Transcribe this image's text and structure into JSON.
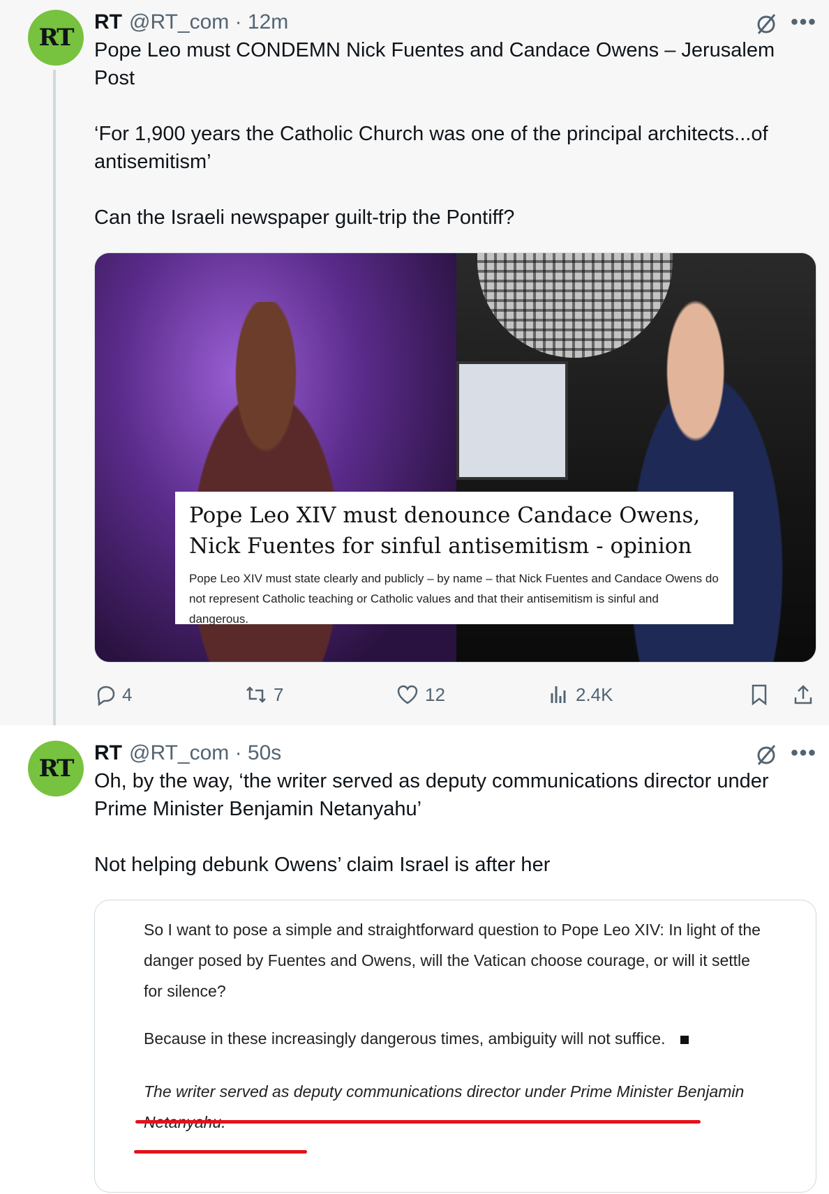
{
  "tweet1": {
    "avatar_text": "RT",
    "name": "RT",
    "handle_time": "@RT_com · 12m",
    "body": "Pope Leo must CONDEMN Nick Fuentes and Candace Owens – Jerusalem Post\n\n‘For 1,900 years the Catholic Church was one of the principal architects...of antisemitism’\n\nCan the Israeli newspaper guilt-trip the Pontiff?",
    "card": {
      "title": "Pope Leo XIV must denounce Candace Owens, Nick Fuentes for sinful antisemitism - opinion",
      "description": "Pope Leo XIV must state clearly and publicly – by name – that Nick Fuentes and Candace Owens do not represent Catholic teaching or Catholic values and that their antisemitism is sinful and dangerous."
    },
    "actions": {
      "replies": "4",
      "reposts": "7",
      "likes": "12",
      "views": "2.4K"
    }
  },
  "tweet2": {
    "avatar_text": "RT",
    "name": "RT",
    "handle_time": "@RT_com · 50s",
    "body": "Oh, by the way, ‘the writer served as deputy communications director under Prime Minister Benjamin Netanyahu’\n\nNot helping debunk Owens’ claim Israel is after her",
    "quote": {
      "paragraph1": "So I want to pose a simple and straightforward question to Pope Leo XIV: In light of the danger posed by Fuentes and Owens, will the Vatican choose courage, or will it settle for silence?",
      "paragraph2": "Because in these increasingly dangerous times, ambiguity will not suffice.",
      "italic_line": "The writer served as deputy communications director under Prime Minister Benjamin Netanyahu."
    }
  },
  "colors": {
    "rt_green": "#77c23e",
    "underline_red": "#e3121b",
    "muted_text": "#536471"
  },
  "icons": [
    "grok-slash-icon",
    "more-icon",
    "reply-icon",
    "repost-icon",
    "like-icon",
    "views-icon",
    "bookmark-icon",
    "share-icon"
  ]
}
